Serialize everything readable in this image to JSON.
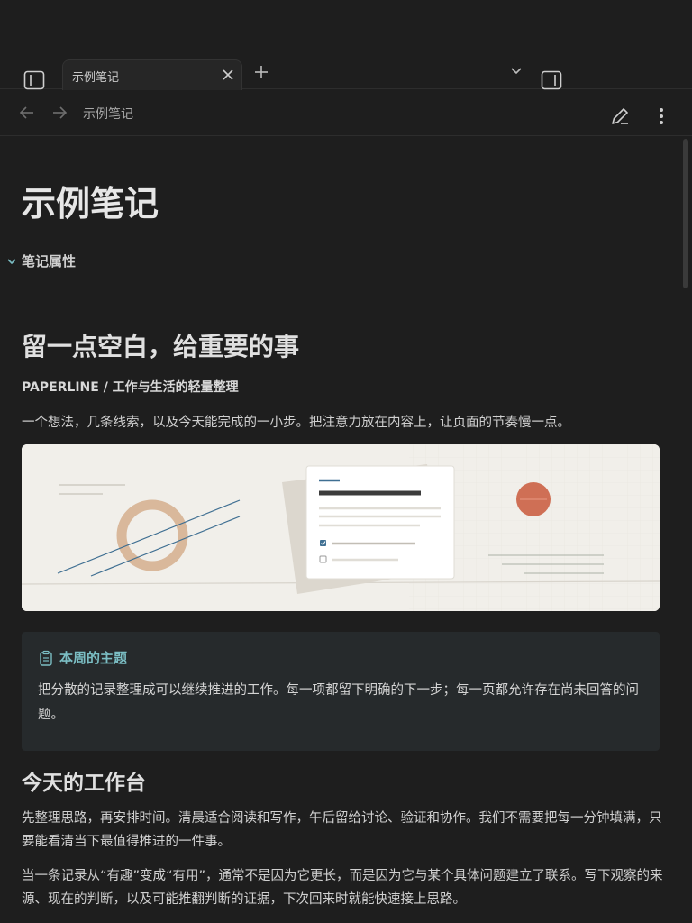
{
  "tab": {
    "title": "示例笔记"
  },
  "nav": {
    "breadcrumb": "示例笔记"
  },
  "note": {
    "title": "示例笔记",
    "properties_label": "笔记属性",
    "heading": "留一点空白，给重要的事",
    "subtitle": "PAPERLINE / 工作与生活的轻量整理",
    "lead": "一个想法，几条线索，以及今天能完成的一小步。把注意力放在内容上，让页面的节奏慢一点。",
    "callout": {
      "title": "本周的主题",
      "body": "把分散的记录整理成可以继续推进的工作。每一项都留下明确的下一步；每一页都允许存在尚未回答的问题。"
    },
    "section_heading": "今天的工作台",
    "paragraphs": [
      "先整理思路，再安排时间。清晨适合阅读和写作，午后留给讨论、验证和协作。我们不需要把每一分钟填满，只要能看清当下最值得推进的一件事。",
      "当一条记录从“有趣”变成“有用”，通常不是因为它更长，而是因为它与某个具体问题建立了联系。写下观察的来源、现在的判断，以及可能推翻判断的证据，下次回来时就能快速接上思路。"
    ]
  },
  "colors": {
    "background": "#1e1e1e",
    "accent": "#7bbec4",
    "banner_bg": "#f1efea",
    "banner_orange": "#cf6f55",
    "banner_ring": "#d9b89b",
    "banner_line_blue": "#3f6f92"
  },
  "icons": {
    "left_sidebar": "sidebar-left-icon",
    "right_sidebar": "sidebar-right-icon",
    "close": "close-icon",
    "new_tab": "plus-icon",
    "tab_list": "chevron-down-icon",
    "back": "arrow-left-icon",
    "forward": "arrow-right-icon",
    "edit": "pencil-icon",
    "more": "more-vertical-icon",
    "callout": "clipboard-icon"
  }
}
